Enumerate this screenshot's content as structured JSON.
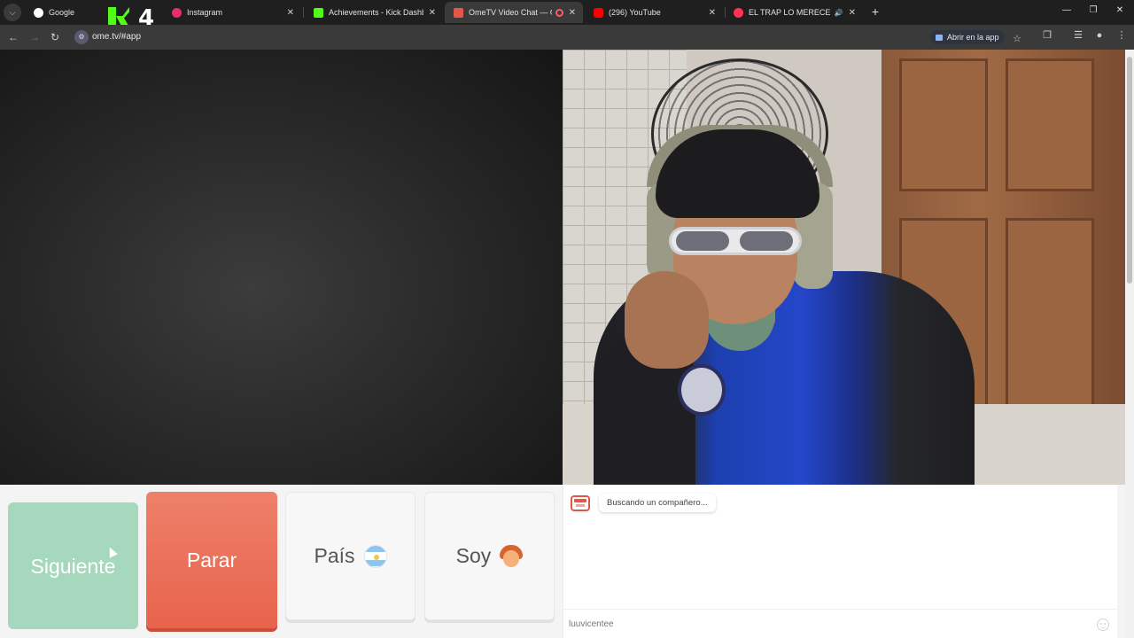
{
  "browser": {
    "tabs": [
      {
        "title": "Google",
        "favicon": "google-icon",
        "color": "#ffffff"
      },
      {
        "title": "Instagram",
        "favicon": "instagram-icon",
        "color": "#e1306c"
      },
      {
        "title": "Achievements - Kick Dashboard",
        "favicon": "kick-icon",
        "color": "#53fc18"
      },
      {
        "title": "OmeTV Video Chat — Ome",
        "favicon": "ometv-icon",
        "color": "#e2574a",
        "active": true
      },
      {
        "title": "(296) YouTube",
        "favicon": "youtube-icon",
        "color": "#ff0000"
      },
      {
        "title": "EL TRAP LO MERECE (con E",
        "favicon": "recording-icon",
        "color": "#ff3355"
      }
    ],
    "kick_overlay_number": "4",
    "url": "ome.tv/#app",
    "open_in_app_label": "Abrir en la app"
  },
  "controls": {
    "next_label": "Siguiente",
    "stop_label": "Parar",
    "country_label": "País",
    "gender_label": "Soy",
    "colors": {
      "next": "#a6d8bd",
      "stop": "#e8634c"
    }
  },
  "chat": {
    "status_message": "Buscando un compañero...",
    "input_value": "luuvicentee"
  }
}
